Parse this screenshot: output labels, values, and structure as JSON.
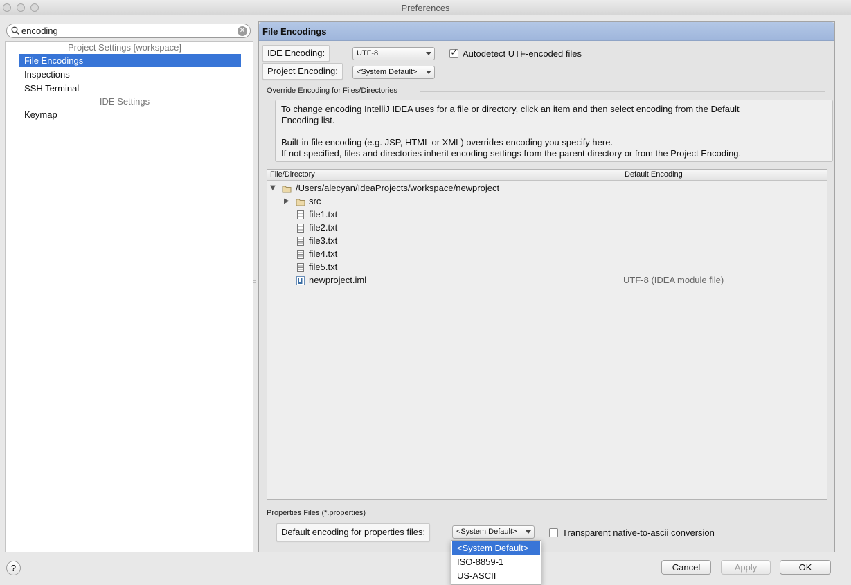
{
  "window": {
    "title": "Preferences"
  },
  "search": {
    "value": "encoding"
  },
  "sidebar": {
    "groups": [
      {
        "title": "Project Settings [workspace]",
        "items": [
          "File Encodings",
          "Inspections",
          "SSH Terminal"
        ]
      },
      {
        "title": "IDE Settings",
        "items": [
          "Keymap"
        ]
      }
    ],
    "selected": "File Encodings"
  },
  "page": {
    "title": "File Encodings"
  },
  "ide_encoding": {
    "label": "IDE Encoding:",
    "value": "UTF-8"
  },
  "project_encoding": {
    "label": "Project Encoding:",
    "value": "<System Default>"
  },
  "autodetect": {
    "label": "Autodetect UTF-encoded files",
    "checked": true
  },
  "override": {
    "title": "Override Encoding for Files/Directories",
    "info_line1": "To change encoding IntelliJ IDEA uses for a file or directory, click an item and then select encoding from the Default",
    "info_line2": "Encoding list.",
    "info_line3": "Built-in file encoding (e.g. JSP, HTML or XML) overrides encoding you specify here.",
    "info_line4": "If not specified, files and directories inherit encoding settings from the parent directory or from the Project Encoding."
  },
  "table": {
    "col_file": "File/Directory",
    "col_encoding": "Default Encoding",
    "rows": [
      {
        "name": "/Users/alecyan/IdeaProjects/workspace/newproject",
        "encoding": "",
        "icon": "folder-icon",
        "toggle": "expanded"
      },
      {
        "name": "src",
        "encoding": "",
        "icon": "folder-icon",
        "toggle": "collapsed"
      },
      {
        "name": "file1.txt",
        "encoding": "",
        "icon": "text-file-icon"
      },
      {
        "name": "file2.txt",
        "encoding": "",
        "icon": "text-file-icon"
      },
      {
        "name": "file3.txt",
        "encoding": "",
        "icon": "text-file-icon"
      },
      {
        "name": "file4.txt",
        "encoding": "",
        "icon": "text-file-icon"
      },
      {
        "name": "file5.txt",
        "encoding": "",
        "icon": "text-file-icon"
      },
      {
        "name": "newproject.iml",
        "encoding": "UTF-8 (IDEA module file)",
        "icon": "module-file-icon"
      }
    ]
  },
  "properties": {
    "title": "Properties Files (*.properties)",
    "label": "Default encoding for properties files:",
    "value": "<System Default>",
    "transparent_label": "Transparent native-to-ascii conversion",
    "transparent_checked": false
  },
  "dropdown": {
    "options": [
      "<System Default>",
      "ISO-8859-1",
      "US-ASCII"
    ],
    "selected": "<System Default>"
  },
  "buttons": {
    "cancel": "Cancel",
    "apply": "Apply",
    "ok": "OK",
    "help": "?"
  },
  "colors": {
    "selection": "#3875d7",
    "header": "#a9bfe2"
  }
}
